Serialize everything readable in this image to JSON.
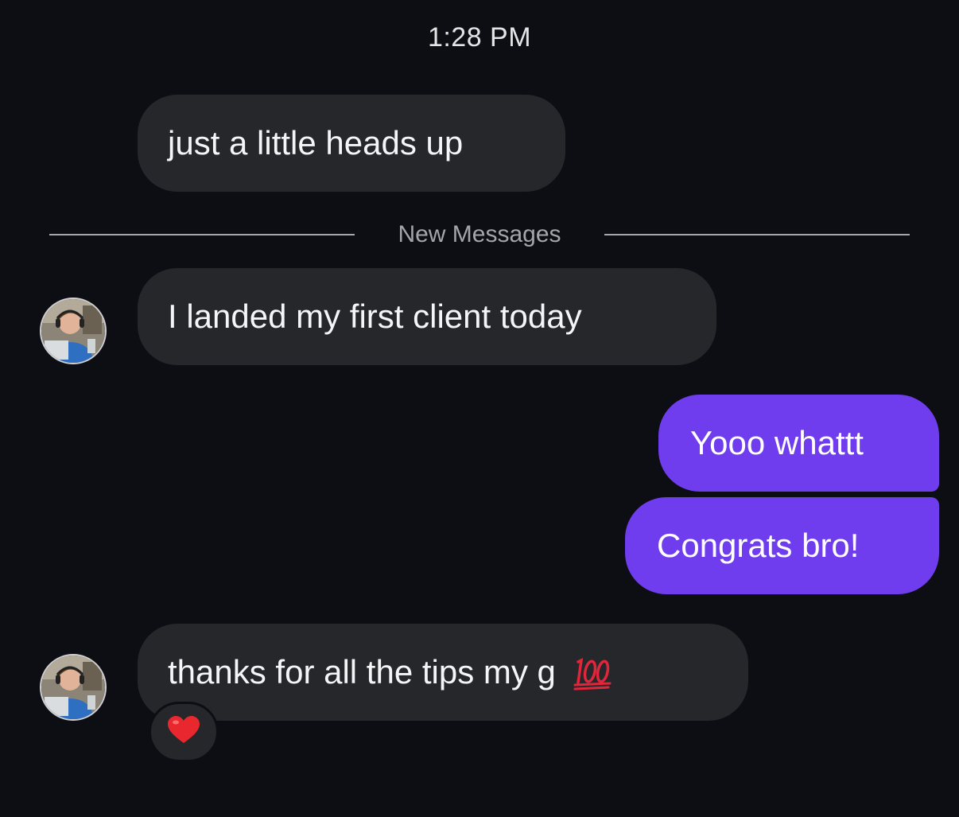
{
  "timestamp": "1:28 PM",
  "divider": {
    "label": "New Messages"
  },
  "messages": [
    {
      "direction": "incoming",
      "text": "just a little heads up"
    },
    {
      "direction": "incoming",
      "text": "I landed my first client today"
    },
    {
      "direction": "outgoing",
      "text": "Yooo whattt"
    },
    {
      "direction": "outgoing",
      "text": "Congrats bro!"
    },
    {
      "direction": "incoming",
      "text": "thanks for all the tips my g",
      "emoji": "hundred-points-icon",
      "reaction": "red-heart-icon"
    }
  ],
  "colors": {
    "background": "#0d0e13",
    "incoming_bubble": "#26272b",
    "outgoing_bubble": "#6f3ded",
    "divider_line": "#a6a6ab"
  }
}
